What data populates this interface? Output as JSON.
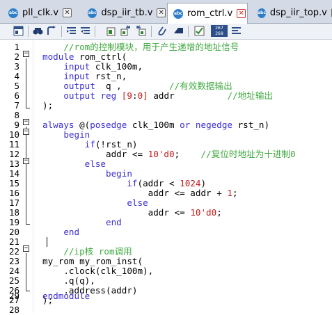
{
  "tabs": [
    {
      "label": "pll_clk.v",
      "icon": "verilog-file-icon",
      "icon_text": "abc",
      "active": false
    },
    {
      "label": "dsp_iir_tb.v",
      "icon": "verilog-file-icon",
      "icon_text": "abc",
      "active": false
    },
    {
      "label": "rom_ctrl.v",
      "icon": "verilog-file-icon",
      "icon_text": "abc",
      "active": true
    },
    {
      "label": "dsp_iir_top.v",
      "icon": "verilog-file-icon",
      "icon_text": "abc",
      "active": false
    }
  ],
  "tab_close_glyph": "✕",
  "toolbar": {
    "buttons": [
      "print-preview-icon",
      "find-icon",
      "goto-icon",
      "indent-icon",
      "outdent-icon",
      "bookmark-icon",
      "next-bookmark-icon",
      "prev-bookmark-icon",
      "attach-icon",
      "comment-icon",
      "verify-icon",
      "line-numbers-icon",
      "format-icon"
    ],
    "line_number_badge": [
      "267",
      "268"
    ]
  },
  "editor": {
    "lines": [
      {
        "n": "1",
        "text": "    //rom的控制模块，用于产生递增的地址信号"
      },
      {
        "n": "2",
        "text": "module rom_ctrl("
      },
      {
        "n": "3",
        "text": "    input clk_100m,"
      },
      {
        "n": "4",
        "text": "    input rst_n,"
      },
      {
        "n": "5",
        "text": "    output  q ,         //有效数据输出"
      },
      {
        "n": "6",
        "text": "    output reg [9:0] addr          //地址输出"
      },
      {
        "n": "7",
        "text": ");"
      },
      {
        "n": "8",
        "text": ""
      },
      {
        "n": "9",
        "text": "always @(posedge clk_100m or negedge rst_n)"
      },
      {
        "n": "10",
        "text": "    begin"
      },
      {
        "n": "11",
        "text": "        if(!rst_n)"
      },
      {
        "n": "12",
        "text": "            addr <= 10'd0;    //复位时地址为十进制0"
      },
      {
        "n": "13",
        "text": "        else"
      },
      {
        "n": "14",
        "text": "            begin"
      },
      {
        "n": "15",
        "text": "                if(addr < 1024)"
      },
      {
        "n": "16",
        "text": "                    addr <= addr + 1;"
      },
      {
        "n": "17",
        "text": "                else"
      },
      {
        "n": "18",
        "text": "                    addr <= 10'd0;"
      },
      {
        "n": "19",
        "text": "            end"
      },
      {
        "n": "20",
        "text": "    end"
      },
      {
        "n": "21",
        "text": ""
      },
      {
        "n": "22",
        "text": "    //ip核 rom调用"
      },
      {
        "n": "23",
        "text": "my_rom my_rom_inst("
      },
      {
        "n": "24",
        "text": "    .clock(clk_100m),"
      },
      {
        "n": "25",
        "text": "    .q(q),"
      },
      {
        "n": "26",
        "text": "    .address(addr)"
      },
      {
        "n": "27",
        "text": ");"
      },
      {
        "n": "28",
        "text": ""
      },
      {
        "n": "29",
        "text": "endmodule"
      }
    ]
  },
  "colors": {
    "keyword": "#3a2fd1",
    "comment": "#3fa93f",
    "number": "#c21a1a",
    "tab_bar": "#d4dbe6",
    "file_icon": "#2f7fc8"
  }
}
